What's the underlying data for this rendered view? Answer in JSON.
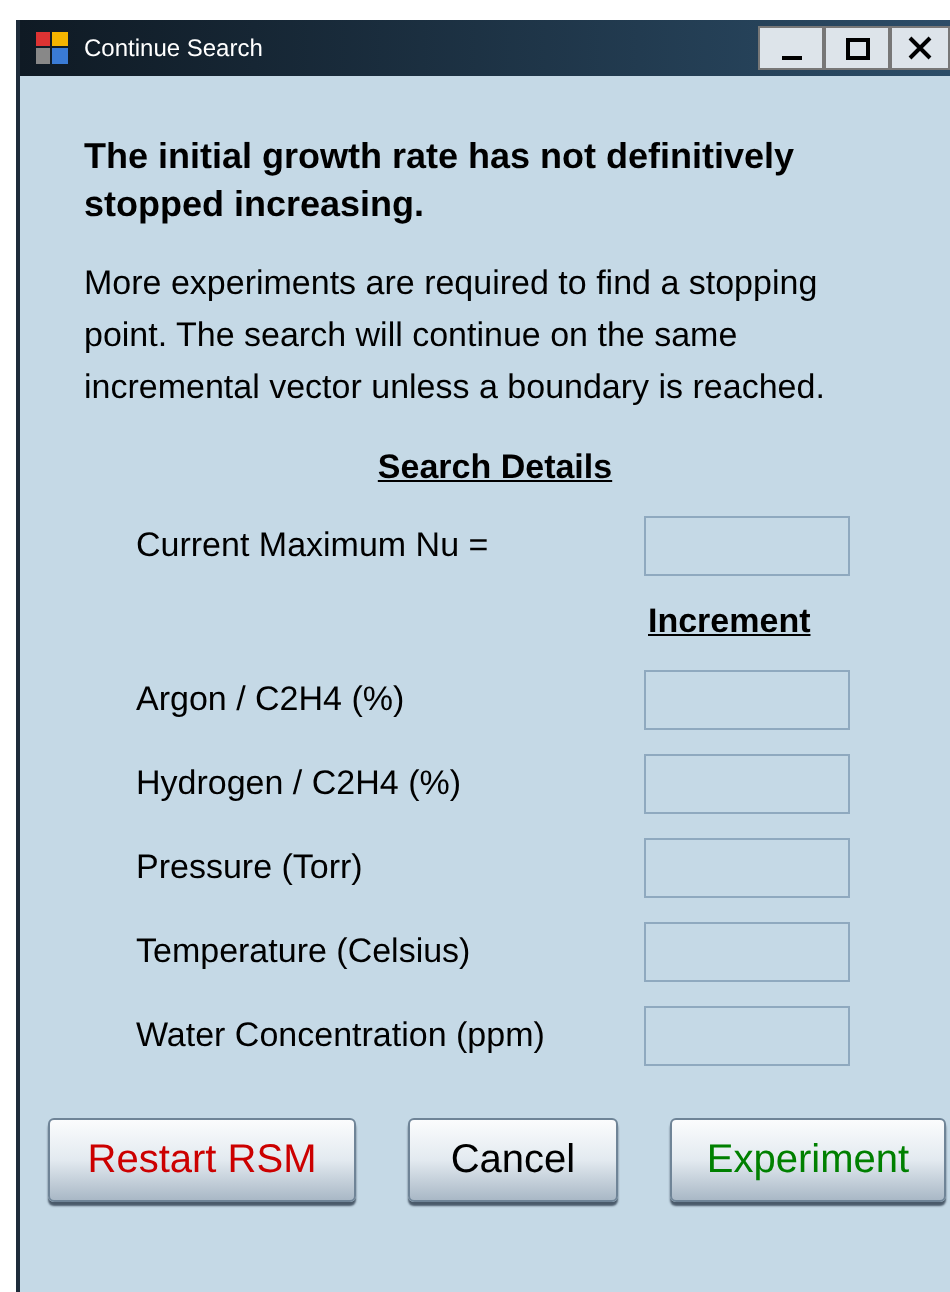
{
  "window": {
    "title": "Continue Search"
  },
  "heading": "The initial growth rate has not definitively stopped increasing.",
  "message": "More experiments are required to find a stopping point. The search will continue on the same incremental vector unless a boundary is reached.",
  "section_title": "Search Details",
  "current_field": {
    "label": "Current Maximum Nu ="
  },
  "increment_header": "Increment",
  "increments": [
    {
      "label": "Argon / C2H4 (%)"
    },
    {
      "label": "Hydrogen / C2H4 (%)"
    },
    {
      "label": "Pressure (Torr)"
    },
    {
      "label": "Temperature (Celsius)"
    },
    {
      "label": "Water Concentration (ppm)"
    }
  ],
  "buttons": [
    {
      "label": "Restart RSM",
      "color": "#cc0000"
    },
    {
      "label": "Cancel",
      "color": "#000000"
    },
    {
      "label": "Experiment",
      "color": "#008000"
    }
  ]
}
